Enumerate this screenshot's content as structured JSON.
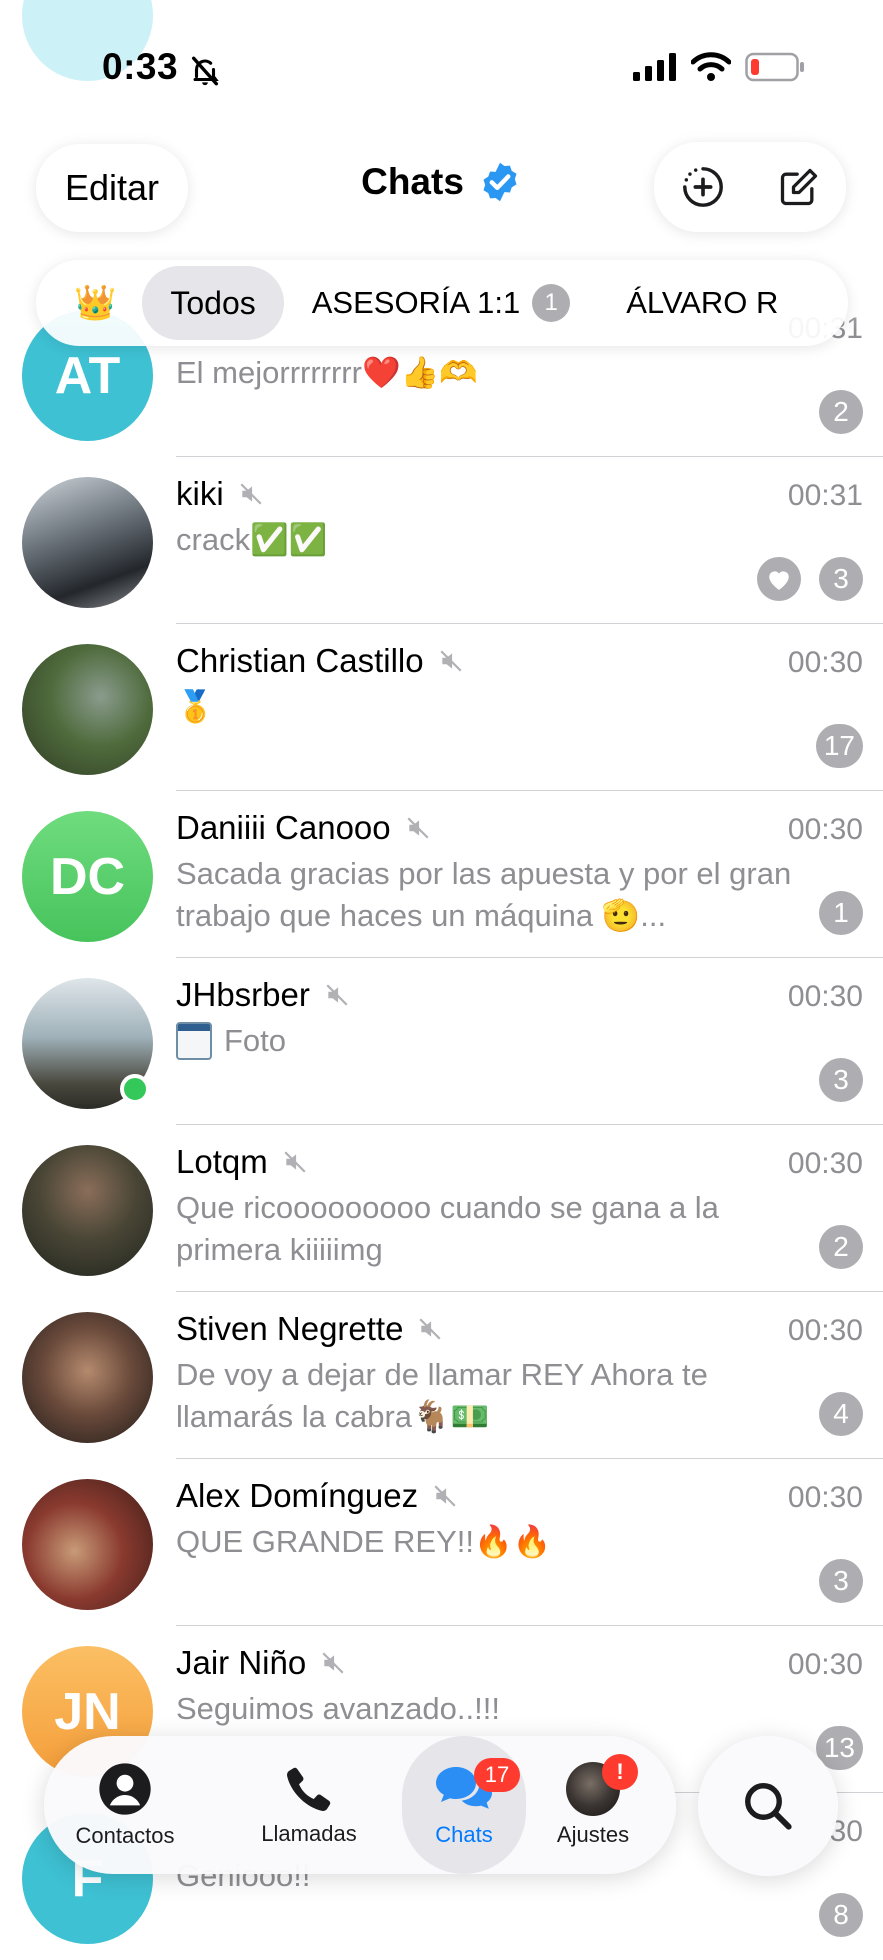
{
  "status_bar": {
    "time": "0:33"
  },
  "header": {
    "edit_label": "Editar",
    "title": "Chats"
  },
  "folders": [
    {
      "label": "👑"
    },
    {
      "label": "Todos"
    },
    {
      "label": "ASESORÍA 1:1",
      "count": "1"
    },
    {
      "label": "ÁLVARO R"
    }
  ],
  "chats": [
    {
      "initials": "AT",
      "name": "",
      "preview": "El mejorrrrrrrr❤️👍🫶",
      "time": "00:31",
      "unread": "2",
      "color": "#3ec1d3"
    },
    {
      "initials": "",
      "name": "kiki",
      "preview": "crack✅✅",
      "time": "00:31",
      "unread": "3",
      "color": "#4a4f57"
    },
    {
      "initials": "",
      "name": "Christian Castillo",
      "preview": "🥇",
      "time": "00:30",
      "unread": "17",
      "color": "#4d6b3a"
    },
    {
      "initials": "DC",
      "name": "Daniiii Canooo",
      "preview": "Sacada gracias por las apuesta y por el gran trabajo que haces un máquina 🫡...",
      "time": "00:30",
      "unread": "1",
      "color": "#5cd16e"
    },
    {
      "initials": "",
      "name": "JHbsrber",
      "preview": "Foto",
      "time": "00:30",
      "unread": "3",
      "color": "#8ea3ad"
    },
    {
      "initials": "",
      "name": "Lotqm",
      "preview": "Que ricooooooooo cuando se gana a la primera kiiiiimg",
      "time": "00:30",
      "unread": "2",
      "color": "#3a3f35"
    },
    {
      "initials": "",
      "name": "Stiven Negrette",
      "preview": "De voy a dejar de llamar REY Ahora te llamarás la cabra🐐💵",
      "time": "00:30",
      "unread": "4",
      "color": "#5b4136"
    },
    {
      "initials": "",
      "name": "Alex Domínguez",
      "preview": "QUE GRANDE REY!!🔥🔥",
      "time": "00:30",
      "unread": "3",
      "color": "#7a2c26"
    },
    {
      "initials": "JN",
      "name": "Jair Niño",
      "preview": "Seguimos avanzado..!!!",
      "time": "00:30",
      "unread": "13",
      "color": "#f7a94b"
    },
    {
      "initials": "F",
      "name": "",
      "preview": "Geniooo!!",
      "time": "30",
      "unread": "8",
      "color": "#3ec1d3"
    }
  ],
  "tabbar": {
    "contacts": "Contactos",
    "calls": "Llamadas",
    "chats": "Chats",
    "chats_badge": "17",
    "settings": "Ajustes",
    "settings_badge": "!"
  }
}
